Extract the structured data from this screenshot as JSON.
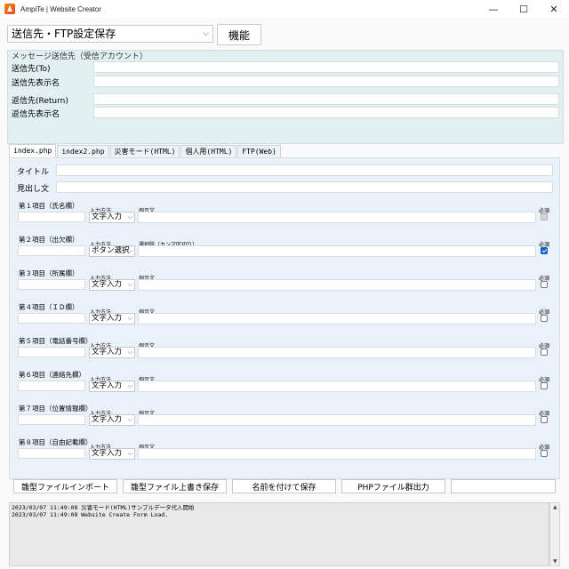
{
  "window": {
    "title": "AmpiTe | Website Creator",
    "minimize": "—",
    "maximize": "☐",
    "close": "✕"
  },
  "toolbar": {
    "destination_select": "送信先・FTP設定保存",
    "function_button": "機能"
  },
  "message_group": {
    "legend": "メッセージ送信先（受信アカウント）",
    "to_label": "送信先(To)",
    "to_name_label": "送信先表示名",
    "return_label": "返信先(Return)",
    "return_name_label": "返信先表示名"
  },
  "tabs": [
    {
      "label": "index.php",
      "active": true
    },
    {
      "label": "index2.php",
      "active": false
    },
    {
      "label": "災害モード(HTML)",
      "active": false
    },
    {
      "label": "個人用(HTML)",
      "active": false
    },
    {
      "label": "FTP(Web)",
      "active": false
    }
  ],
  "form": {
    "title_label": "タイトル",
    "heading_label": "見出し文",
    "method_label": "入力方法",
    "required_label": "必須",
    "items": [
      {
        "title": "第１項目（氏名欄）",
        "method": "文字入力",
        "example_label": "例示文",
        "required": "disabled"
      },
      {
        "title": "第２項目（出欠欄）",
        "method": "ボタン選択",
        "example_label": "選択肢（カンマ区切り）",
        "required": "checked"
      },
      {
        "title": "第３項目（所属欄）",
        "method": "文字入力",
        "example_label": "例示文",
        "required": "unchecked"
      },
      {
        "title": "第４項目（ＩＤ欄）",
        "method": "文字入力",
        "example_label": "例示文",
        "required": "unchecked"
      },
      {
        "title": "第５項目（電話番号欄）",
        "method": "文字入力",
        "example_label": "例示文",
        "required": "unchecked"
      },
      {
        "title": "第６項目（連絡先欄）",
        "method": "文字入力",
        "example_label": "例示文",
        "required": "unchecked"
      },
      {
        "title": "第７項目（位置情報欄）",
        "method": "文字入力",
        "example_label": "例示文",
        "required": "unchecked"
      },
      {
        "title": "第８項目（自由記載欄）",
        "method": "文字入力",
        "example_label": "例示文",
        "required": "unchecked"
      }
    ]
  },
  "bottom_buttons": [
    {
      "label": "雛型ファイルインポート"
    },
    {
      "label": "雛型ファイル上書き保存"
    },
    {
      "label": "名前を付けて保存"
    },
    {
      "label": "PHPファイル群出力"
    },
    {
      "label": ""
    }
  ],
  "log": {
    "lines": [
      "2023/03/07 11:49:08 災害モード(HTML)サンプルデータ代入開始",
      "2023/03/07 11:49:08 Website Create Form Load."
    ]
  },
  "icons": {
    "chevron": "⌵",
    "scroll_up": "▲",
    "scroll_down": "▼"
  },
  "colors": {
    "msg_group_bg": "#e2f0f1",
    "tab_panel_bg": "#e9f2fb",
    "checkbox_checked": "#0a5fc4"
  }
}
